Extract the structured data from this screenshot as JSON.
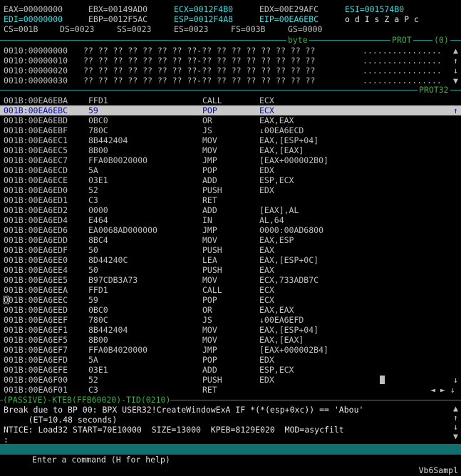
{
  "registers": {
    "line1": [
      {
        "text": "EAX=00000000",
        "hl": false
      },
      {
        "text": "EBX=00149AD0",
        "hl": false
      },
      {
        "text": "ECX=0012F4B0",
        "hl": true
      },
      {
        "text": "EDX=00E29AFC",
        "hl": false
      },
      {
        "text": "ESI=001574B0",
        "hl": true
      }
    ],
    "line2": [
      {
        "text": "EDI=00000000",
        "hl": true
      },
      {
        "text": "EBP=0012F5AC",
        "hl": false
      },
      {
        "text": "ESP=0012F4A8",
        "hl": true
      },
      {
        "text": "EIP=00EA6EBC",
        "hl": true
      }
    ],
    "flags": "o d I s Z a P c",
    "line3": [
      "CS=001B",
      "DS=0023",
      "SS=0023",
      "ES=0023",
      "FS=003B",
      "GS=0000"
    ]
  },
  "data_window": {
    "tag_byte": "byte",
    "tag_prot": "PROT",
    "tag_zero": "(0)",
    "rows": [
      {
        "addr": "0010:00000000",
        "bytes": "?? ?? ?? ?? ?? ?? ?? ??-?? ?? ?? ?? ?? ?? ?? ??",
        "ascii": "................",
        "arrow": "▲"
      },
      {
        "addr": "0010:00000010",
        "bytes": "?? ?? ?? ?? ?? ?? ?? ??-?? ?? ?? ?? ?? ?? ?? ??",
        "ascii": "................",
        "arrow": "↑"
      },
      {
        "addr": "0010:00000020",
        "bytes": "?? ?? ?? ?? ?? ?? ?? ??-?? ?? ?? ?? ?? ?? ?? ??",
        "ascii": "................",
        "arrow": "↓"
      },
      {
        "addr": "0010:00000030",
        "bytes": "?? ?? ?? ?? ?? ?? ?? ??-?? ?? ?? ?? ?? ?? ?? ??",
        "ascii": "................",
        "arrow": "▼"
      }
    ]
  },
  "code_window": {
    "tag": "PROT32",
    "rows": [
      {
        "addr": "001B:00EA6EBA",
        "bytes": "FFD1",
        "mn": "CALL",
        "op": "ECX"
      },
      {
        "addr": "001B:00EA6EBC",
        "bytes": "59",
        "mn": "POP",
        "op": "ECX",
        "current": true
      },
      {
        "addr": "001B:00EA6EBD",
        "bytes": "0BC0",
        "mn": "OR",
        "op": "EAX,EAX"
      },
      {
        "addr": "001B:00EA6EBF",
        "bytes": "780C",
        "mn": "JS",
        "op": "↓00EA6ECD"
      },
      {
        "addr": "001B:00EA6EC1",
        "bytes": "8B442404",
        "mn": "MOV",
        "op": "EAX,[ESP+04]"
      },
      {
        "addr": "001B:00EA6EC5",
        "bytes": "8B00",
        "mn": "MOV",
        "op": "EAX,[EAX]"
      },
      {
        "addr": "001B:00EA6EC7",
        "bytes": "FFA0B0020000",
        "mn": "JMP",
        "op": "[EAX+000002B0]"
      },
      {
        "addr": "001B:00EA6ECD",
        "bytes": "5A",
        "mn": "POP",
        "op": "EDX"
      },
      {
        "addr": "001B:00EA6ECE",
        "bytes": "03E1",
        "mn": "ADD",
        "op": "ESP,ECX"
      },
      {
        "addr": "001B:00EA6ED0",
        "bytes": "52",
        "mn": "PUSH",
        "op": "EDX"
      },
      {
        "addr": "001B:00EA6ED1",
        "bytes": "C3",
        "mn": "RET",
        "op": ""
      },
      {
        "addr": "001B:00EA6ED2",
        "bytes": "0000",
        "mn": "ADD",
        "op": "[EAX],AL"
      },
      {
        "addr": "001B:00EA6ED4",
        "bytes": "E464",
        "mn": "IN",
        "op": "AL,64"
      },
      {
        "addr": "001B:00EA6ED6",
        "bytes": "EA0068AD000000",
        "mn": "JMP",
        "op": "0000:00AD6800"
      },
      {
        "addr": "001B:00EA6EDD",
        "bytes": "8BC4",
        "mn": "MOV",
        "op": "EAX,ESP"
      },
      {
        "addr": "001B:00EA6EDF",
        "bytes": "50",
        "mn": "PUSH",
        "op": "EAX"
      },
      {
        "addr": "001B:00EA6EE0",
        "bytes": "8D44240C",
        "mn": "LEA",
        "op": "EAX,[ESP+0C]"
      },
      {
        "addr": "001B:00EA6EE4",
        "bytes": "50",
        "mn": "PUSH",
        "op": "EAX"
      },
      {
        "addr": "001B:00EA6EE5",
        "bytes": "B97CDB3A73",
        "mn": "MOV",
        "op": "ECX,733ADB7C"
      },
      {
        "addr": "001B:00EA6EEA",
        "bytes": "FFD1",
        "mn": "CALL",
        "op": "ECX"
      },
      {
        "addr": "001B:00EA6EEC",
        "bytes": "59",
        "mn": "POP",
        "op": "ECX",
        "cursor": true
      },
      {
        "addr": "001B:00EA6EED",
        "bytes": "0BC0",
        "mn": "OR",
        "op": "EAX,EAX"
      },
      {
        "addr": "001B:00EA6EEF",
        "bytes": "780C",
        "mn": "JS",
        "op": "↓00EA6EFD"
      },
      {
        "addr": "001B:00EA6EF1",
        "bytes": "8B442404",
        "mn": "MOV",
        "op": "EAX,[ESP+04]"
      },
      {
        "addr": "001B:00EA6EF5",
        "bytes": "8B00",
        "mn": "MOV",
        "op": "EAX,[EAX]"
      },
      {
        "addr": "001B:00EA6EF7",
        "bytes": "FFA0B4020000",
        "mn": "JMP",
        "op": "[EAX+000002B4]"
      },
      {
        "addr": "001B:00EA6EFD",
        "bytes": "5A",
        "mn": "POP",
        "op": "EDX"
      },
      {
        "addr": "001B:00EA6EFE",
        "bytes": "03E1",
        "mn": "ADD",
        "op": "ESP,ECX"
      },
      {
        "addr": "001B:00EA6F00",
        "bytes": "52",
        "mn": "PUSH",
        "op": "EDX"
      },
      {
        "addr": "001B:00EA6F01",
        "bytes": "C3",
        "mn": "RET",
        "op": ""
      }
    ],
    "arrow_up": "↑",
    "arrow_down": "↓",
    "scroll_lr": "◄ ► ↓"
  },
  "command_window": {
    "status_tag": "(PASSIVE)-KTEB(FFB60020)-TID(0210)",
    "lines": [
      "Break due to BP 00: BPX USER32!CreateWindowExA IF *(*(esp+0xc)) == 'Abou'",
      "     (ET=10.48 seconds)",
      "NTICE: Load32 START=70E10000  SIZE=13000  KPEB=8129E020  MOD=asycfilt",
      ":"
    ],
    "arrows": [
      "▲",
      "↑",
      "↓",
      "▼"
    ]
  },
  "status_bar": {
    "hint": "Enter a command (H for help)",
    "module": "Vb6Sampl"
  },
  "colors": {
    "background": "#000000",
    "text": "#c0c0c0",
    "register_highlight": "#40e0e0",
    "separator": "#10a0a0",
    "tag_green": "#4ab04a",
    "current_line_bg": "#c8c8c8",
    "current_line_text": "#1010a0",
    "status_bar_bg": "#107070"
  }
}
